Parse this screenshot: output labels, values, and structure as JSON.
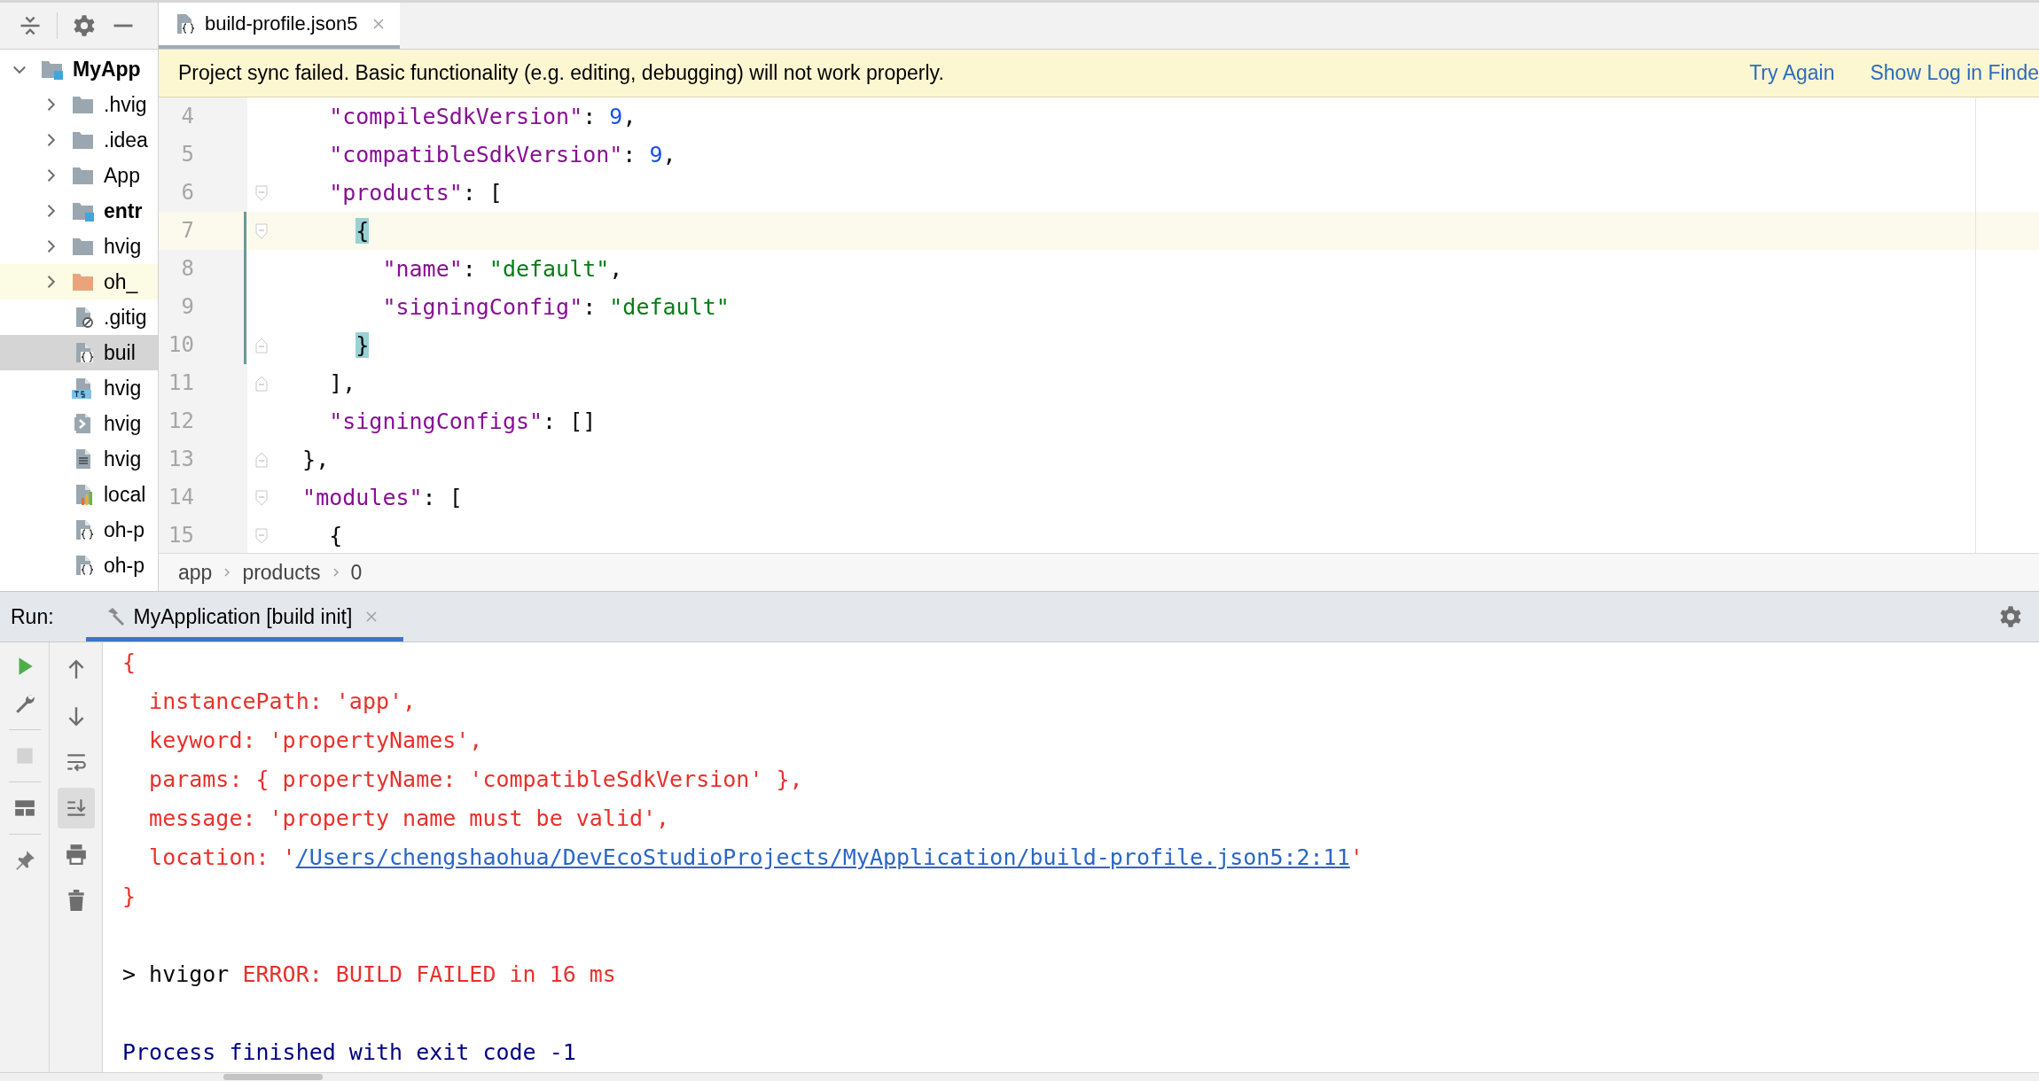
{
  "sidebar": {
    "tree": [
      {
        "label": "MyApp",
        "kind": "module",
        "expanded": true,
        "selected": false,
        "children": [
          {
            "label": ".hvig",
            "kind": "folder",
            "expanded": false,
            "selected": false
          },
          {
            "label": ".idea",
            "kind": "folder",
            "expanded": false,
            "selected": false
          },
          {
            "label": "App",
            "kind": "folder",
            "expanded": false,
            "selected": false
          },
          {
            "label": "entr",
            "kind": "module",
            "expanded": false,
            "selected": false
          },
          {
            "label": "hvig",
            "kind": "folder",
            "expanded": false,
            "selected": false
          },
          {
            "label": "oh_",
            "kind": "excluded",
            "expanded": false,
            "selected": false
          },
          {
            "label": ".gitig",
            "kind": "ignore-file",
            "selected": false
          },
          {
            "label": "buil",
            "kind": "json-file",
            "selected": true
          },
          {
            "label": "hvig",
            "kind": "ts-file",
            "selected": false
          },
          {
            "label": "hvig",
            "kind": "script-file",
            "selected": false
          },
          {
            "label": "hvig",
            "kind": "text-file",
            "selected": false
          },
          {
            "label": "local",
            "kind": "properties-file",
            "selected": false
          },
          {
            "label": "oh-p",
            "kind": "json-file",
            "selected": false
          },
          {
            "label": "oh-p",
            "kind": "json-file",
            "selected": false
          }
        ]
      }
    ]
  },
  "editor": {
    "tabs": [
      {
        "label": "build-profile.json5",
        "selected": true
      }
    ],
    "banner": {
      "message": "Project sync failed. Basic functionality (e.g. editing, debugging) will not work properly.",
      "actions": [
        "Try Again",
        "Show Log in Finde"
      ]
    },
    "lines": [
      {
        "number": "4",
        "current": false,
        "changed": false,
        "fold_start": false,
        "fold_end": false,
        "tokens": [
          {
            "kind": "key",
            "text": "    \"compileSdkVersion\""
          },
          {
            "kind": "plain",
            "text": ": "
          },
          {
            "kind": "number",
            "text": "9"
          },
          {
            "kind": "plain",
            "text": ","
          }
        ]
      },
      {
        "number": "5",
        "current": false,
        "changed": false,
        "fold_start": false,
        "fold_end": false,
        "tokens": [
          {
            "kind": "key",
            "text": "    \"compatibleSdkVersion\""
          },
          {
            "kind": "plain",
            "text": ": "
          },
          {
            "kind": "number",
            "text": "9"
          },
          {
            "kind": "plain",
            "text": ","
          }
        ]
      },
      {
        "number": "6",
        "current": false,
        "changed": false,
        "fold_start": true,
        "fold_end": false,
        "tokens": [
          {
            "kind": "key",
            "text": "    \"products\""
          },
          {
            "kind": "plain",
            "text": ": ["
          }
        ]
      },
      {
        "number": "7",
        "current": true,
        "changed": true,
        "fold_start": true,
        "fold_end": false,
        "tokens": [
          {
            "kind": "plain",
            "text": "      {",
            "matched": true
          }
        ]
      },
      {
        "number": "8",
        "current": false,
        "changed": true,
        "fold_start": false,
        "fold_end": false,
        "tokens": [
          {
            "kind": "key",
            "text": "        \"name\""
          },
          {
            "kind": "plain",
            "text": ": "
          },
          {
            "kind": "string",
            "text": "\"default\""
          },
          {
            "kind": "plain",
            "text": ","
          }
        ]
      },
      {
        "number": "9",
        "current": false,
        "changed": true,
        "fold_start": false,
        "fold_end": false,
        "tokens": [
          {
            "kind": "key",
            "text": "        \"signingConfig\""
          },
          {
            "kind": "plain",
            "text": ": "
          },
          {
            "kind": "string",
            "text": "\"default\""
          }
        ]
      },
      {
        "number": "10",
        "current": false,
        "changed": true,
        "fold_start": false,
        "fold_end": true,
        "tokens": [
          {
            "kind": "plain",
            "text": "      }",
            "matched": true
          }
        ]
      },
      {
        "number": "11",
        "current": false,
        "changed": false,
        "fold_start": false,
        "fold_end": true,
        "tokens": [
          {
            "kind": "plain",
            "text": "    ],"
          }
        ]
      },
      {
        "number": "12",
        "current": false,
        "changed": false,
        "fold_start": false,
        "fold_end": false,
        "tokens": [
          {
            "kind": "key",
            "text": "    \"signingConfigs\""
          },
          {
            "kind": "plain",
            "text": ": []"
          }
        ]
      },
      {
        "number": "13",
        "current": false,
        "changed": false,
        "fold_start": false,
        "fold_end": true,
        "tokens": [
          {
            "kind": "plain",
            "text": "  },"
          }
        ]
      },
      {
        "number": "14",
        "current": false,
        "changed": false,
        "fold_start": true,
        "fold_end": false,
        "tokens": [
          {
            "kind": "key",
            "text": "  \"modules\""
          },
          {
            "kind": "plain",
            "text": ": ["
          }
        ]
      },
      {
        "number": "15",
        "current": false,
        "changed": false,
        "fold_start": true,
        "fold_end": false,
        "tokens": [
          {
            "kind": "plain",
            "text": "    {"
          }
        ]
      }
    ],
    "breadcrumbs": [
      "app",
      "products",
      "0"
    ]
  },
  "run": {
    "label": "Run:",
    "tabs": [
      {
        "label": "MyApplication [build init]",
        "selected": true
      }
    ],
    "left_tools": [
      {
        "kind": "run",
        "disabled": false
      },
      {
        "kind": "wrench",
        "disabled": false
      },
      {
        "kind": "stop",
        "disabled": true
      },
      {
        "kind": "layout",
        "disabled": false
      },
      {
        "kind": "pin",
        "disabled": false
      }
    ],
    "right_tools": [
      {
        "kind": "up",
        "on": false
      },
      {
        "kind": "down",
        "on": false
      },
      {
        "kind": "wrap",
        "on": false
      },
      {
        "kind": "scroll-end",
        "on": true
      },
      {
        "kind": "print",
        "on": false
      },
      {
        "kind": "trash",
        "on": false
      }
    ],
    "console": [
      {
        "blank_before": false,
        "segments": [
          {
            "kind": "error",
            "text": "{"
          }
        ]
      },
      {
        "blank_before": false,
        "segments": [
          {
            "kind": "error",
            "text": "  instancePath: 'app',"
          }
        ]
      },
      {
        "blank_before": false,
        "segments": [
          {
            "kind": "error",
            "text": "  keyword: 'propertyNames',"
          }
        ]
      },
      {
        "blank_before": false,
        "segments": [
          {
            "kind": "error",
            "text": "  params: { propertyName: 'compatibleSdkVersion' },"
          }
        ]
      },
      {
        "blank_before": false,
        "segments": [
          {
            "kind": "error",
            "text": "  message: 'property name must be valid',"
          }
        ]
      },
      {
        "blank_before": false,
        "segments": [
          {
            "kind": "error",
            "text": "  location: '"
          },
          {
            "kind": "link",
            "text": "/Users/chengshaohua/DevEcoStudioProjects/MyApplication/build-profile.json5:2:11"
          },
          {
            "kind": "error",
            "text": "'"
          }
        ]
      },
      {
        "blank_before": false,
        "segments": [
          {
            "kind": "error",
            "text": "}"
          }
        ]
      },
      {
        "blank_before": true,
        "segments": [
          {
            "kind": "normal",
            "text": "> hvigor "
          },
          {
            "kind": "error",
            "text": "ERROR: BUILD FAILED in 16 ms"
          }
        ]
      },
      {
        "blank_before": true,
        "segments": [
          {
            "kind": "info",
            "text": "Process finished with exit code -1"
          }
        ]
      }
    ]
  }
}
